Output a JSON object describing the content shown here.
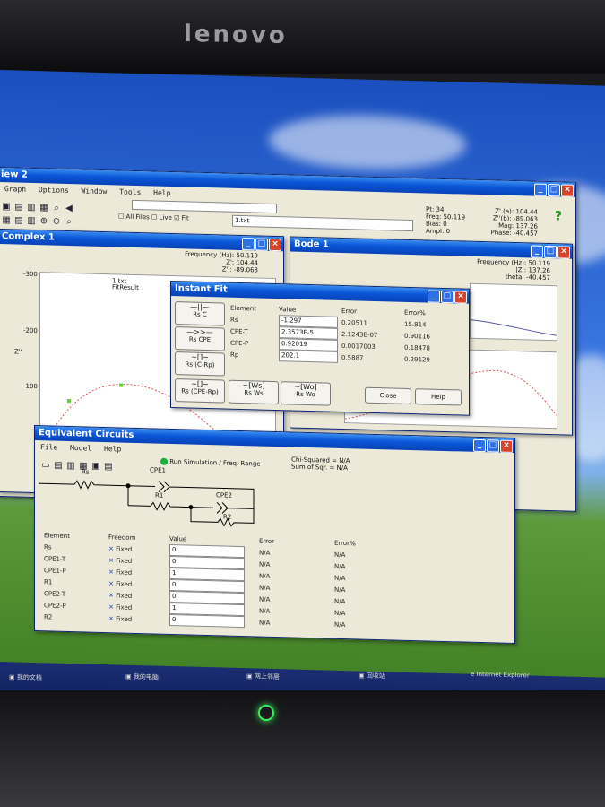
{
  "monitor": {
    "brand": "lenovo"
  },
  "main_window": {
    "title": "iew 2",
    "menu": [
      "Graph",
      "Options",
      "Window",
      "Tools",
      "Help"
    ],
    "toolbar": {
      "all_files": "All Files",
      "live": "Live",
      "fit": "Fit",
      "file": "1.txt"
    },
    "readout_left": {
      "pt": "Pt: 34",
      "freq": "Freq: 50.119",
      "bias": "Bias: 0",
      "ampl": "Ampl: 0"
    },
    "readout_right": {
      "z_real": "Z' (a): 104.44",
      "z_imag": "Z''(b): -89.063",
      "mag": "Mag: 137.26",
      "phase": "Phase: -40.457"
    },
    "help_icon": "?"
  },
  "complex_window": {
    "title": "Complex 1",
    "freq": "Frequency (Hz): 50.119",
    "z": "Z': 104.44",
    "z2": "Z'': -89.063",
    "yticks": [
      "-300",
      "-200",
      "-100"
    ],
    "ylabel": "Z''",
    "legend": [
      "1.txt",
      "FitResult"
    ]
  },
  "bode_window": {
    "title": "Bode 1",
    "freq": "Frequency (Hz): 50.119",
    "z": "|Z|: 137.26",
    "theta": "theta: -40.457"
  },
  "instant_fit": {
    "title": "Instant Fit",
    "headers": [
      "Element",
      "Value",
      "Error",
      "Error%"
    ],
    "rows": [
      {
        "element": "Rs",
        "value": "-1.297",
        "error": "0.20511",
        "errorp": "15.814"
      },
      {
        "element": "CPE-T",
        "value": "2.3573E-5",
        "error": "2.1243E-07",
        "errorp": "0.90116"
      },
      {
        "element": "CPE-P",
        "value": "0.92019",
        "error": "0.0017003",
        "errorp": "0.18478"
      },
      {
        "element": "Rp",
        "value": "202.1",
        "error": "0.5887",
        "errorp": "0.29129"
      }
    ],
    "circuits": [
      "Rs C",
      "Rs CPE",
      "Rs (C-Rp)",
      "Rs (CPE-Rp)",
      "Rs Ws",
      "Rs Wo"
    ],
    "close": "Close",
    "help": "Help"
  },
  "equiv": {
    "title": "Equivalent Circuits",
    "menu": [
      "File",
      "Model",
      "Help"
    ],
    "run": "Run Simulation / Freq. Range",
    "chi": "Chi-Squared = N/A",
    "sum": "Sum of Sqr. = N/A",
    "circuit_labels": [
      "Rs",
      "CPE1",
      "R1",
      "CPE2",
      "R2"
    ],
    "headers": [
      "Element",
      "Freedom",
      "Value",
      "Error",
      "Error%"
    ],
    "rows": [
      {
        "element": "Rs",
        "freedom": "Fixed",
        "value": "0",
        "error": "N/A",
        "errorp": "N/A"
      },
      {
        "element": "CPE1-T",
        "freedom": "Fixed",
        "value": "0",
        "error": "N/A",
        "errorp": "N/A"
      },
      {
        "element": "CPE1-P",
        "freedom": "Fixed",
        "value": "1",
        "error": "N/A",
        "errorp": "N/A"
      },
      {
        "element": "R1",
        "freedom": "Fixed",
        "value": "0",
        "error": "N/A",
        "errorp": "N/A"
      },
      {
        "element": "CPE2-T",
        "freedom": "Fixed",
        "value": "0",
        "error": "N/A",
        "errorp": "N/A"
      },
      {
        "element": "CPE2-P",
        "freedom": "Fixed",
        "value": "1",
        "error": "N/A",
        "errorp": "N/A"
      },
      {
        "element": "R2",
        "freedom": "Fixed",
        "value": "0",
        "error": "N/A",
        "errorp": "N/A"
      }
    ]
  },
  "taskbar": {
    "items": [
      "我的文档",
      "我的电脑",
      "网上邻居",
      "回收站",
      "Internet Explorer"
    ]
  }
}
